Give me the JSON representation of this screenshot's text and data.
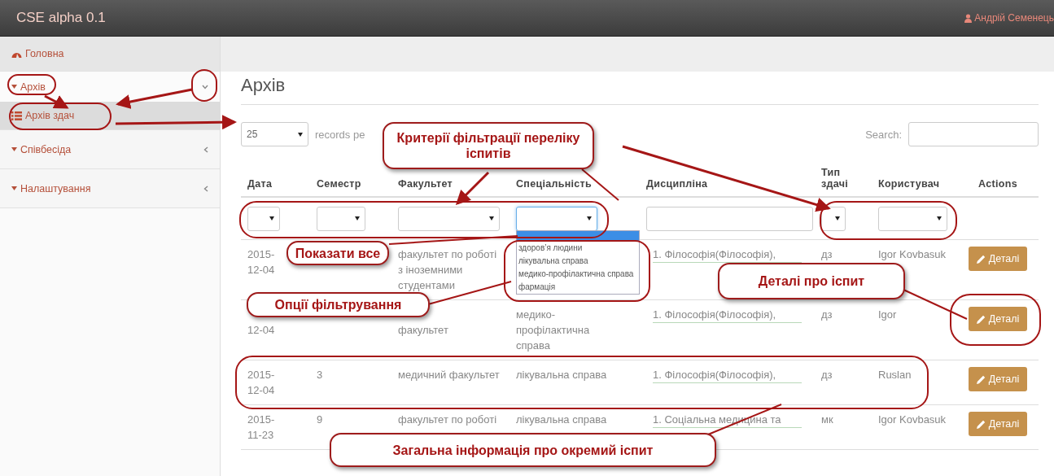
{
  "app": {
    "title": "CSE alpha 0.1",
    "user": "Андрій Семенець"
  },
  "sidebar": {
    "items": [
      {
        "kind": "link",
        "label": "Головна"
      },
      {
        "kind": "group",
        "label": "Архів",
        "expanded": true,
        "children": [
          {
            "label": "Архів здач",
            "selected": true
          }
        ]
      },
      {
        "kind": "group",
        "label": "Співбесіда",
        "expanded": false
      },
      {
        "kind": "group",
        "label": "Налаштування",
        "expanded": false
      }
    ]
  },
  "page": {
    "title": "Архів",
    "page_size": "25",
    "page_size_label": "records pe",
    "search_label": "Search:"
  },
  "table": {
    "columns": [
      {
        "label": "Дата"
      },
      {
        "label": "Семестр"
      },
      {
        "label": "Факультет"
      },
      {
        "label": "Спеціальність"
      },
      {
        "label": "Дисципліна"
      },
      {
        "label": "Тип здачі"
      },
      {
        "label": "Користувач"
      },
      {
        "label": "Actions"
      }
    ],
    "filters": [
      {
        "kind": "select",
        "open": false
      },
      {
        "kind": "select",
        "open": false
      },
      {
        "kind": "select",
        "open": false
      },
      {
        "kind": "select",
        "open": true
      },
      {
        "kind": "text",
        "open": false
      },
      {
        "kind": "select",
        "open": false
      },
      {
        "kind": "select",
        "open": false
      }
    ],
    "filter_dropdown": {
      "blank_highlighted": true,
      "options": [
        "здоров’я людини",
        "лікувальна справа",
        "медико-профілактична справа",
        "фармація"
      ]
    },
    "rows": [
      {
        "date": "2015-12-04",
        "faculty": "факультет по роботі з іноземними студентами",
        "discipline": "1. Філософія(Філософія),",
        "type": "дз",
        "user": "Igor Kovbasuk",
        "action": "Деталі"
      },
      {
        "date": "12-04",
        "faculty": "факультет",
        "specialty": "медико-профілактична справа",
        "discipline": "1. Філософія(Філософія),",
        "type": "дз",
        "user": "Igor",
        "action": "Деталі"
      },
      {
        "date": "2015-12-04",
        "semester": "3",
        "faculty": "медичний факультет",
        "specialty": "лікувальна справа",
        "discipline": "1. Філософія(Філософія),",
        "type": "дз",
        "user": "Ruslan",
        "action": "Деталі"
      },
      {
        "date": "2015-11-23",
        "semester": "9",
        "faculty": "факультет по роботі",
        "specialty": "лікувальна справа",
        "discipline": "1. Соціальна медицина та",
        "type": "мк",
        "user": "Igor Kovbasuk",
        "action": "Деталі"
      }
    ]
  },
  "annotations": [
    {
      "kind": "callout",
      "text": "Критерії фільтрації переліку іспитів"
    },
    {
      "kind": "callout",
      "text": "Показати все"
    },
    {
      "kind": "callout",
      "text": "Опції фільтрування"
    },
    {
      "kind": "callout",
      "text": "Деталі про іспит"
    },
    {
      "kind": "callout",
      "text": "Загальна інформація про окремий іспит"
    }
  ]
}
